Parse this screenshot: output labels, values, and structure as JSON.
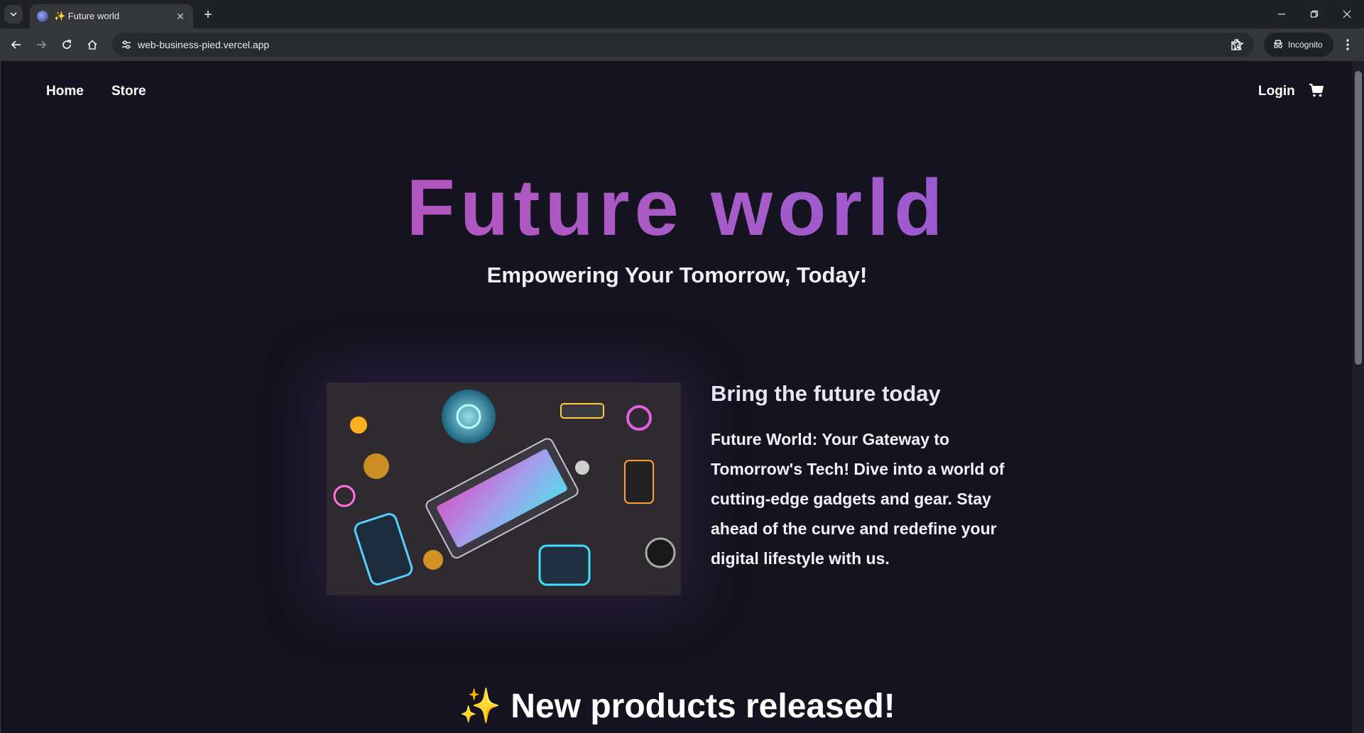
{
  "browser": {
    "tab_title": "✨ Future world",
    "url": "web-business-pied.vercel.app",
    "profile_label": "Incógnito",
    "icons": [
      "tab-search-icon",
      "favicon-icon",
      "close-icon",
      "new-tab-icon",
      "minimize-icon",
      "restore-icon",
      "window-close-icon",
      "back-icon",
      "forward-icon",
      "reload-icon",
      "home-icon",
      "site-info-icon",
      "bookmark-star-icon",
      "extensions-icon",
      "incognito-icon",
      "menu-icon"
    ]
  },
  "nav": {
    "home": "Home",
    "store": "Store",
    "login": "Login",
    "cart_icon": "cart-icon"
  },
  "hero": {
    "title": "Future world",
    "subtitle": "Empowering Your Tomorrow, Today!"
  },
  "feature": {
    "title": "Bring the future today",
    "description": "Future World: Your Gateway to Tomorrow's Tech! Dive into a world of cutting-edge gadgets and gear. Stay ahead of the curve and redefine your digital lifestyle with us."
  },
  "section": {
    "title": "✨ New products released!"
  },
  "colors": {
    "background": "#14131f",
    "gradient_start": "#c34fb3",
    "gradient_end": "#8a57e0"
  }
}
